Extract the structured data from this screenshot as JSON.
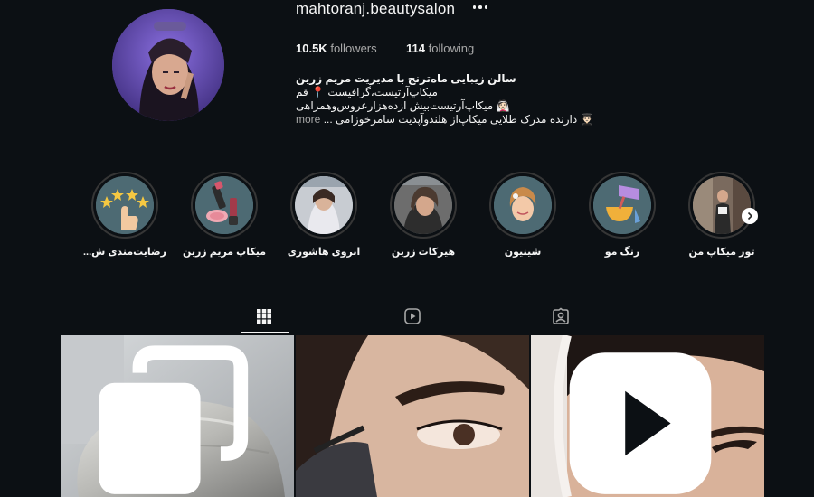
{
  "profile": {
    "username": "mahtoranj.beautysalon",
    "followers_count": "10.5K",
    "followers_label": "followers",
    "following_count": "114",
    "following_label": "following",
    "bio": {
      "title": "سالن زیبایی ماه‌ترنج با مدیریت مریم زرین",
      "line1": "میکاپ‌آرتیست،گرافیست 📍 قم",
      "line2": "👰🏻 میکاپ‌آرتیست‌بیش ازده‌هزارعروس‌وهمراهی",
      "line3": "👨🏻‍🎓 دارنده مدرک طلایی میکاپ‌از هلندوآپدیت سامرخوزامی ...",
      "more": "more"
    }
  },
  "highlights": [
    {
      "label": "رضایت‌مندی ش...",
      "icon": "stars-hand-icon"
    },
    {
      "label": "میکاپ مریم زرین",
      "icon": "makeup-icon"
    },
    {
      "label": "ابروی هاشوری",
      "icon": "portrait-photo-icon"
    },
    {
      "label": "هیرکات زرین",
      "icon": "haircut-photo-icon"
    },
    {
      "label": "شینیون",
      "icon": "updo-icon"
    },
    {
      "label": "رنگ مو",
      "icon": "hair-dye-icon"
    },
    {
      "label": "تور میکاپ من",
      "icon": "tour-photo-icon"
    }
  ],
  "tabs": [
    {
      "name": "posts",
      "icon": "grid-icon",
      "active": true
    },
    {
      "name": "reels",
      "icon": "reels-icon",
      "active": false
    },
    {
      "name": "tagged",
      "icon": "tagged-icon",
      "active": false
    }
  ],
  "posts": [
    {
      "type": "carousel",
      "icon": "carousel-icon"
    },
    {
      "type": "image",
      "icon": ""
    },
    {
      "type": "reel",
      "icon": "reel-play-icon"
    }
  ],
  "colors": {
    "background": "#0c1014",
    "text": "#f5f5f5",
    "muted": "#a8a8a8",
    "highlight_ring": "#363636"
  }
}
